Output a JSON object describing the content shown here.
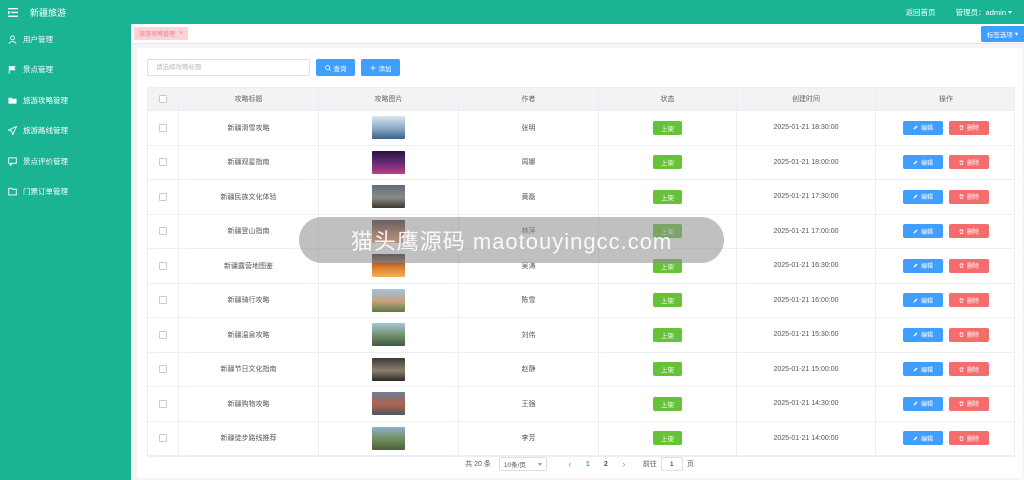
{
  "app": {
    "title": "新疆旅游"
  },
  "sidebar": {
    "items": [
      {
        "label": "用户管理",
        "icon": "user-icon"
      },
      {
        "label": "景点管理",
        "icon": "flag-icon"
      },
      {
        "label": "旅游攻略管理",
        "icon": "folder-icon"
      },
      {
        "label": "旅游路线管理",
        "icon": "send-icon"
      },
      {
        "label": "景点评价管理",
        "icon": "comment-icon"
      },
      {
        "label": "门票订单管理",
        "icon": "document-icon"
      }
    ]
  },
  "header": {
    "home_link": "返回首页",
    "admin_label": "管理员：admin"
  },
  "tabs": {
    "active_tab": "旅游攻略管理",
    "options_label": "标签选项"
  },
  "toolbar": {
    "search_placeholder": "请选择攻略标题",
    "query_label": "查询",
    "add_label": "添加"
  },
  "table": {
    "columns": [
      "攻略标题",
      "攻略图片",
      "作者",
      "状态",
      "创建时间",
      "操作"
    ],
    "edit_label": "编辑",
    "delete_label": "删除",
    "rows": [
      {
        "title": "新疆滑雪攻略",
        "author": "张明",
        "status": "上架",
        "created": "2025-01-21 18:30:00",
        "thumb": [
          "#d9e6ef",
          "#8aa8c4",
          "#3a5f85"
        ]
      },
      {
        "title": "新疆观星指南",
        "author": "周娜",
        "status": "上架",
        "created": "2025-01-21 18:00:00",
        "thumb": [
          "#2b1240",
          "#6a2c7a",
          "#c0407e"
        ]
      },
      {
        "title": "新疆民族文化体验",
        "author": "黄磊",
        "status": "上架",
        "created": "2025-01-21 17:30:00",
        "thumb": [
          "#5d6c7d",
          "#8b8c86",
          "#3a3630"
        ]
      },
      {
        "title": "新疆登山指南",
        "author": "林萍",
        "status": "上架",
        "created": "2025-01-21 17:00:00",
        "thumb": [
          "#3b2a2a",
          "#b56a4a",
          "#e8a070"
        ]
      },
      {
        "title": "新疆露营地图鉴",
        "author": "吴涛",
        "status": "上架",
        "created": "2025-01-21 16:30:00",
        "thumb": [
          "#1f2b3d",
          "#d9772a",
          "#f0b35a"
        ]
      },
      {
        "title": "新疆骑行攻略",
        "author": "陈雪",
        "status": "上架",
        "created": "2025-01-21 16:00:00",
        "thumb": [
          "#9ec3e0",
          "#c7a078",
          "#5a7a4a"
        ]
      },
      {
        "title": "新疆温泉攻略",
        "author": "刘伟",
        "status": "上架",
        "created": "2025-01-21 15:30:00",
        "thumb": [
          "#a7c4d8",
          "#6f8f6a",
          "#3e5a3c"
        ]
      },
      {
        "title": "新疆节日文化指南",
        "author": "赵静",
        "status": "上架",
        "created": "2025-01-21 15:00:00",
        "thumb": [
          "#3d3a35",
          "#8a7f6e",
          "#2b2824"
        ]
      },
      {
        "title": "新疆购物攻略",
        "author": "王强",
        "status": "上架",
        "created": "2025-01-21 14:30:00",
        "thumb": [
          "#6b7f99",
          "#b0624a",
          "#4a5566"
        ]
      },
      {
        "title": "新疆徒步路线推荐",
        "author": "李芳",
        "status": "上架",
        "created": "2025-01-21 14:00:00",
        "thumb": [
          "#8fb0cc",
          "#6f8c5a",
          "#4c5e3c"
        ]
      }
    ]
  },
  "pagination": {
    "total": "共 20 条",
    "page_size": "10条/页",
    "pages": [
      "1",
      "2"
    ],
    "goto_label": "前往",
    "goto_value": "1",
    "page_unit": "页"
  },
  "watermark": "猫头鹰源码 maotouyingcc.com",
  "colors": {
    "brand": "#1ab394",
    "primary": "#409eff",
    "success": "#67c23a",
    "danger": "#f56c6c"
  }
}
